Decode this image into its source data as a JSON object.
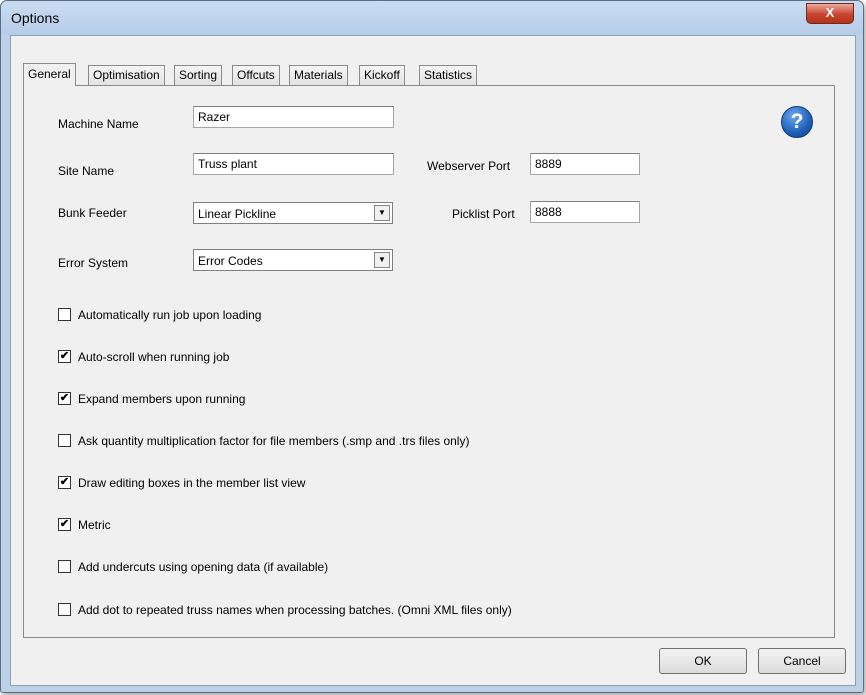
{
  "window": {
    "title": "Options",
    "close_glyph": "X"
  },
  "tabs": [
    "General",
    "Optimisation",
    "Sorting",
    "Offcuts",
    "Materials",
    "Kickoff",
    "Statistics"
  ],
  "general": {
    "machine_name_label": "Machine Name",
    "machine_name_value": "Razer",
    "site_name_label": "Site Name",
    "site_name_value": "Truss plant",
    "bunk_feeder_label": "Bunk Feeder",
    "bunk_feeder_value": "Linear Pickline",
    "error_system_label": "Error System",
    "error_system_value": "Error Codes",
    "webserver_port_label": "Webserver Port",
    "webserver_port_value": "8889",
    "picklist_port_label": "Picklist Port",
    "picklist_port_value": "8888",
    "help_glyph": "?"
  },
  "checkboxes": [
    {
      "label": "Automatically run job upon loading",
      "checked": false
    },
    {
      "label": "Auto-scroll when running job",
      "checked": true
    },
    {
      "label": "Expand members upon running",
      "checked": true
    },
    {
      "label": "Ask quantity multiplication factor for file members (.smp and .trs files only)",
      "checked": false
    },
    {
      "label": "Draw editing boxes in the member list view",
      "checked": true
    },
    {
      "label": "Metric",
      "checked": true
    },
    {
      "label": "Add undercuts using opening data (if available)",
      "checked": false
    },
    {
      "label": "Add dot to repeated truss names when processing batches. (Omni XML files only)",
      "checked": false
    }
  ],
  "check_glyph": "✔",
  "buttons": {
    "ok": "OK",
    "cancel": "Cancel"
  }
}
